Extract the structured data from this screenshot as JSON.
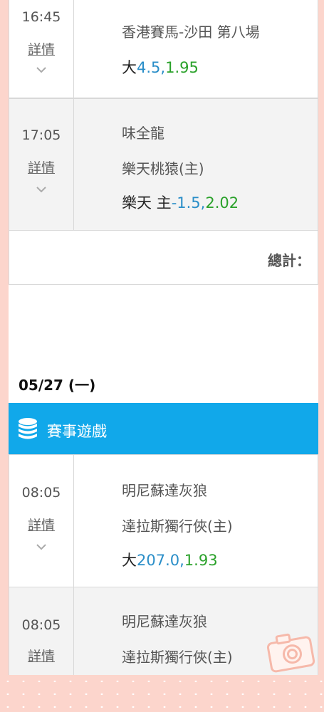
{
  "rows": [
    {
      "time": "16:45",
      "detail": "詳情",
      "lines": [
        "香港賽馬-沙田 第八場"
      ],
      "bet": {
        "prefix": "大",
        "handicap": "4.5,",
        "odds": "1.95"
      }
    },
    {
      "time": "17:05",
      "detail": "詳情",
      "lines": [
        "味全龍",
        "樂天桃猿(主)"
      ],
      "bet": {
        "prefix": "樂天 主",
        "handicap": "-1.5,",
        "odds": "2.02"
      }
    },
    {
      "time": "08:05",
      "detail": "詳情",
      "lines": [
        "明尼蘇達灰狼",
        "達拉斯獨行俠(主)"
      ],
      "bet": {
        "prefix": "大",
        "handicap": "207.0,",
        "odds": "1.93"
      }
    },
    {
      "time": "08:05",
      "detail": "詳情",
      "lines": [
        "明尼蘇達灰狼",
        "達拉斯獨行俠(主)"
      ]
    }
  ],
  "total_label": "總計：",
  "date_header": "05/27 (一)",
  "section": {
    "title": "賽事遊戲",
    "icon": "coin-stack-icon"
  },
  "colors": {
    "banner": "#11a8ea",
    "handicap": "#2a8ec8",
    "odds": "#2aa12a",
    "background": "#fcd5cc"
  }
}
